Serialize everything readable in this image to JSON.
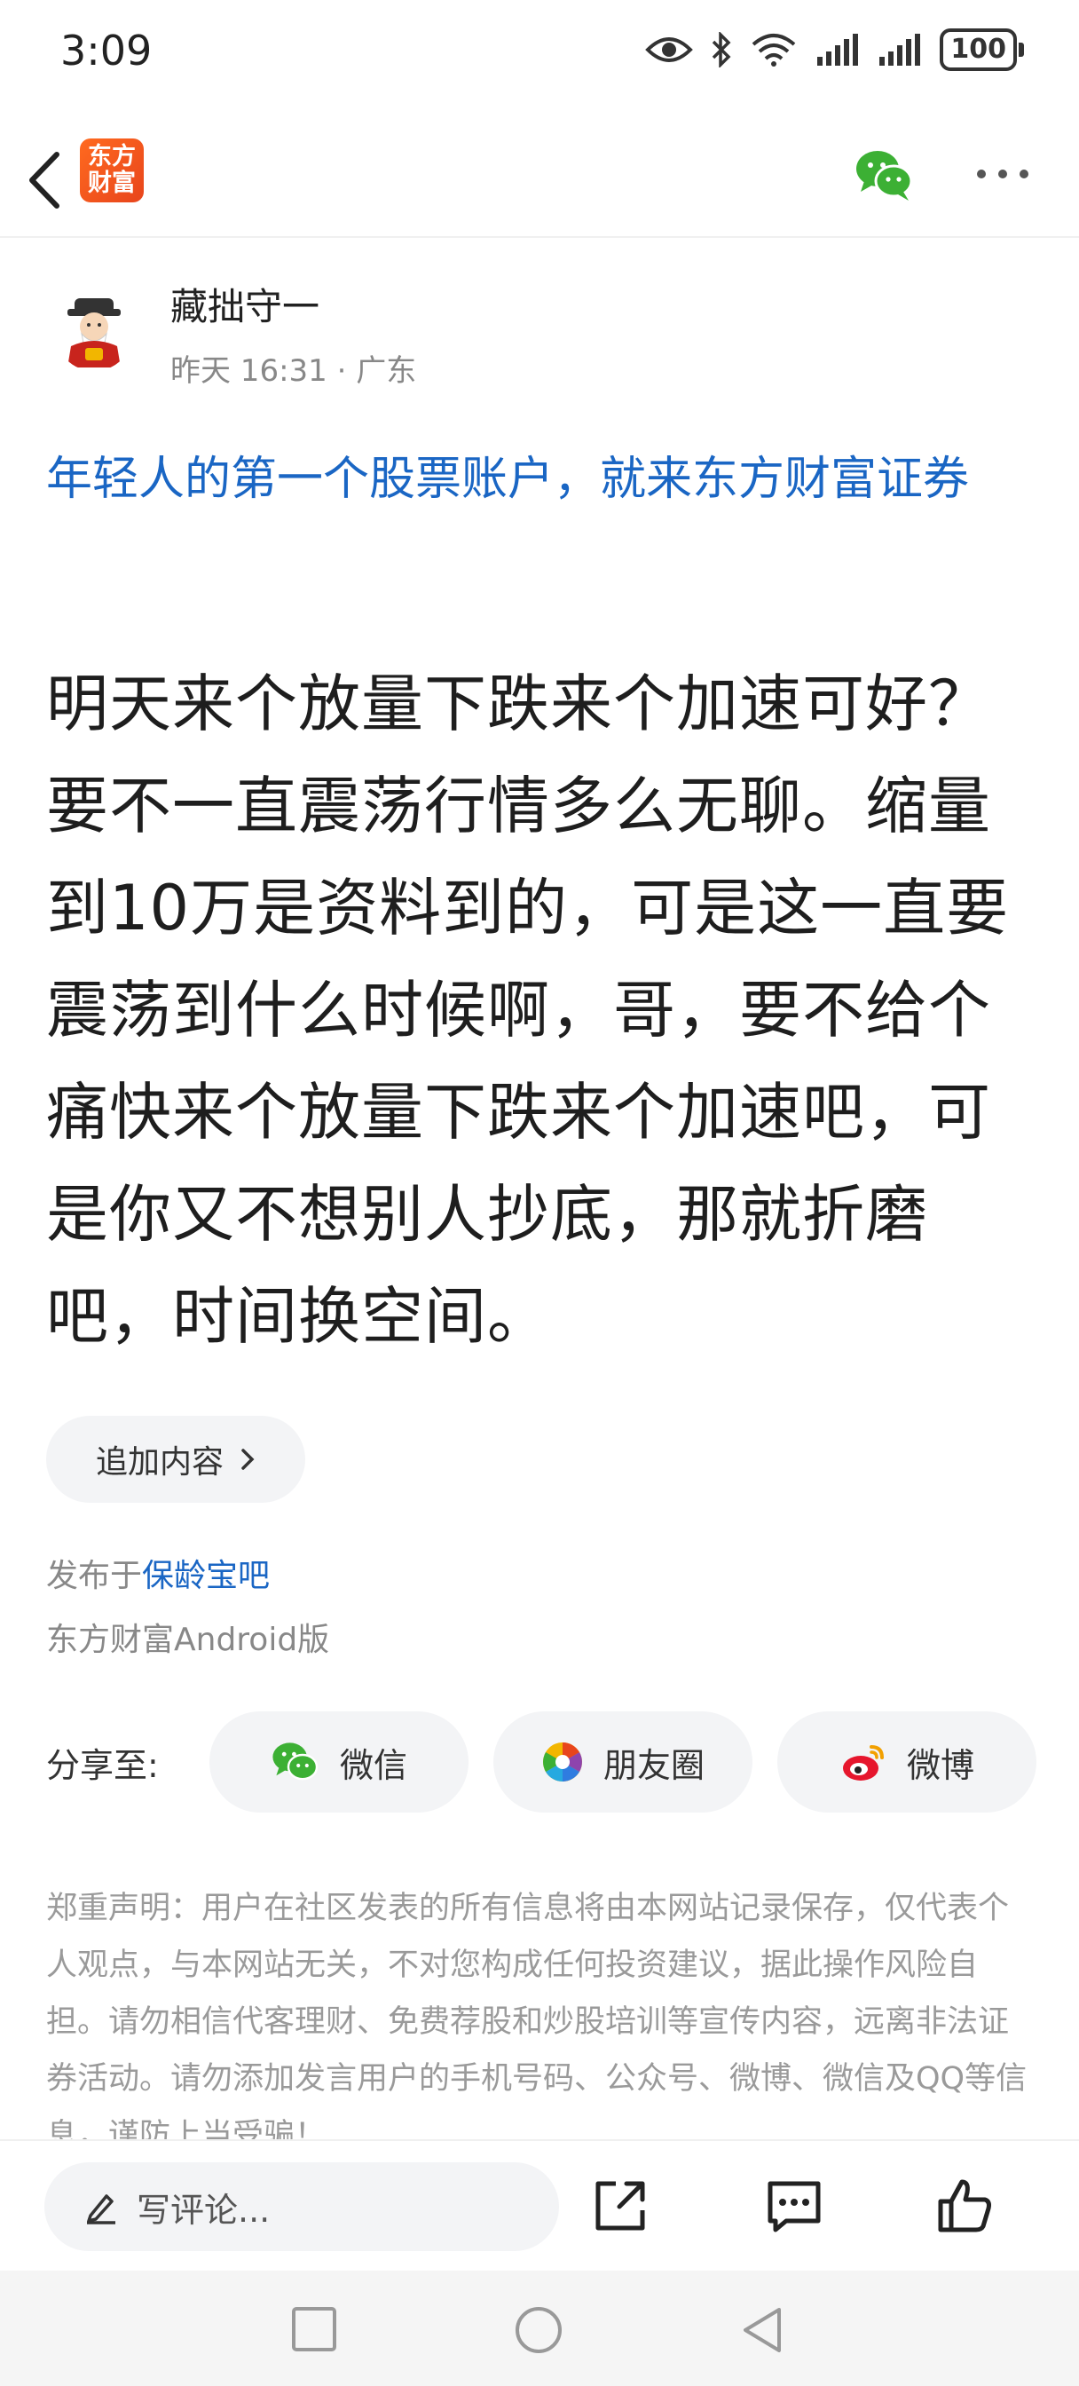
{
  "status_bar": {
    "time": "3:09",
    "battery": "100"
  },
  "header": {
    "logo_text_line1": "东方",
    "logo_text_line2": "财富"
  },
  "post": {
    "author": "藏拙守一",
    "date": "昨天 16:31",
    "location": "广东",
    "ad_link": "年轻人的第一个股票账户，就来东方财富证券",
    "body": "明天来个放量下跌来个加速可好？要不一直震荡行情多么无聊。缩量到10万是资料到的，可是这一直要震荡到什么时候啊，哥，要不给个痛快来个放量下跌来个加速吧，可是你又不想别人抄底，那就折磨吧，时间换空间。",
    "append_label": "追加内容",
    "published_prefix": "发布于",
    "bar_name": "保龄宝吧",
    "client": "东方财富Android版"
  },
  "share": {
    "label": "分享至:",
    "wechat": "微信",
    "moments": "朋友圈",
    "weibo": "微博"
  },
  "disclaimer": "郑重声明：用户在社区发表的所有信息将由本网站记录保存，仅代表个人观点，与本网站无关，不对您构成任何投资建议，据此操作风险自担。请勿相信代客理财、免费荐股和炒股培训等宣传内容，远离非法证券活动。请勿添加发言用户的手机号码、公众号、微博、微信及QQ等信息，谨防上当受骗！",
  "bottom_bar": {
    "comment_placeholder": "写评论..."
  },
  "colors": {
    "link_blue": "#1a66c4",
    "brand_orange": "#ff6a1f",
    "wechat_green": "#3cb034"
  }
}
